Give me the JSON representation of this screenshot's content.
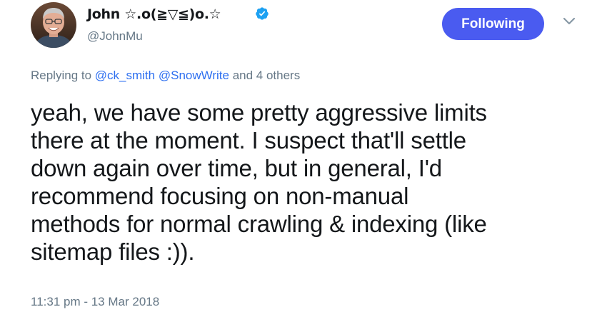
{
  "author": {
    "display_name": "John ☆.o(≧▽≦)o.☆",
    "handle": "@JohnMu",
    "verified": true
  },
  "follow_button": {
    "label": "Following",
    "color": "#4a5bf0"
  },
  "menu": {
    "icon": "chevron-down-icon"
  },
  "reply": {
    "prefix": "Replying to ",
    "mentions": [
      "@ck_smith",
      "@SnowWrite"
    ],
    "suffix": " and 4 others"
  },
  "tweet": {
    "lines": [
      "yeah, we have some pretty aggressive limits",
      "there at the moment. I suspect that'll settle",
      "down again over time, but in general, I'd",
      "recommend focusing on non-manual",
      "methods for normal crawling & indexing (like",
      "sitemap files :))."
    ],
    "timestamp": "11:31 pm - 13 Mar 2018"
  },
  "colors": {
    "link": "#2d6ff0",
    "muted": "#657786",
    "verified": "#1da1f2"
  }
}
